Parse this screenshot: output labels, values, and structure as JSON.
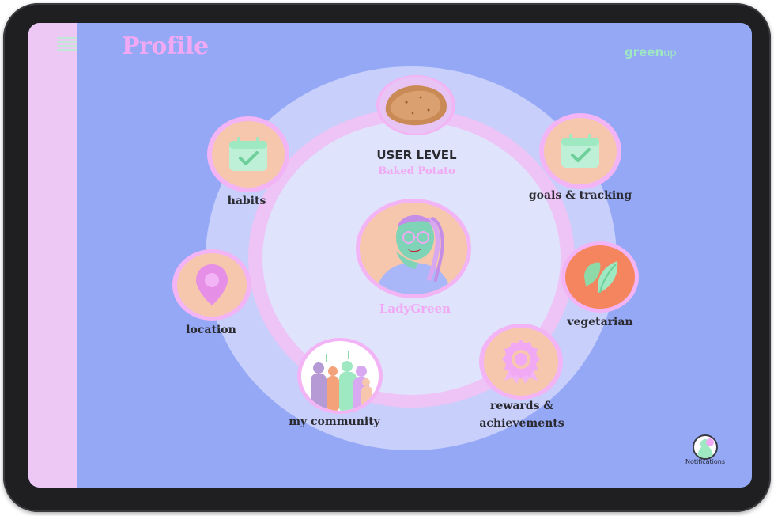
{
  "header": {
    "title": "Profile",
    "brand_main": "green",
    "brand_sub": "up"
  },
  "user": {
    "level_title": "USER LEVEL",
    "level_value": "Baked Potato",
    "username": "LadyGreen"
  },
  "nodes": {
    "habits": "habits",
    "goals": "goals & tracking",
    "location": "location",
    "vegetarian": "vegetarian",
    "rewards_line1": "rewards &",
    "rewards_line2": "achievements",
    "community": "my community"
  },
  "notifications": {
    "label": "Notifications"
  },
  "colors": {
    "background": "#95a8f6",
    "sidebar": "#eec8f5",
    "accent_pink": "#f1a9f4",
    "mint": "#9ee8c2",
    "peach": "#f7c7ad",
    "orange": "#f4855e"
  }
}
